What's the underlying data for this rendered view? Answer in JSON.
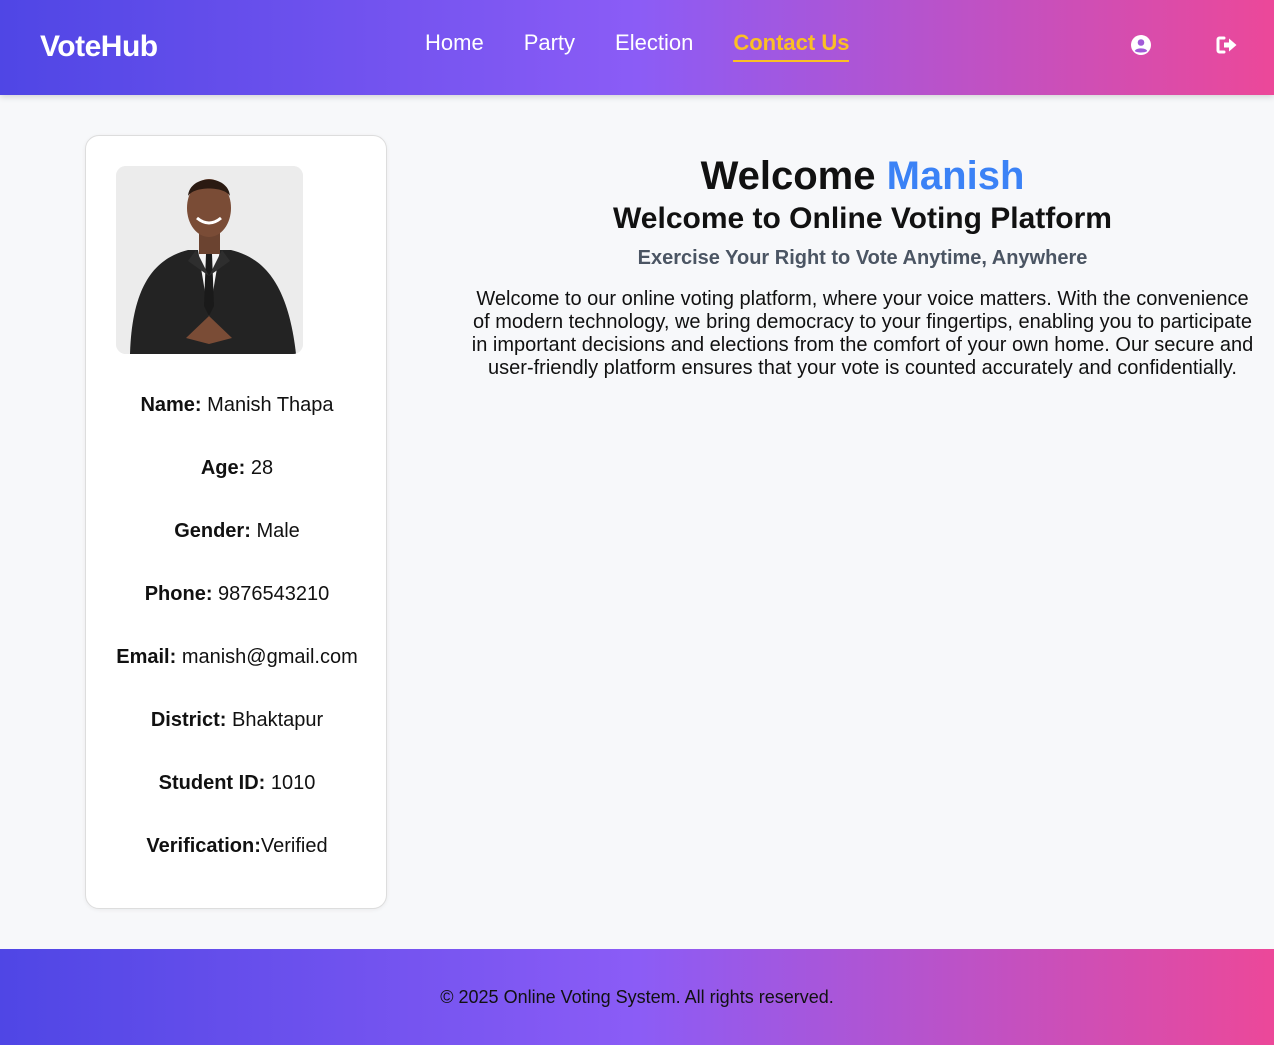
{
  "navbar": {
    "brand": "VoteHub",
    "links": [
      {
        "label": "Home",
        "active": false
      },
      {
        "label": "Party",
        "active": false
      },
      {
        "label": "Election",
        "active": false
      },
      {
        "label": "Contact Us",
        "active": true
      }
    ],
    "icons": [
      "user-circle-icon",
      "logout-icon"
    ]
  },
  "profile": {
    "name_label": "Name:",
    "name": "Manish Thapa",
    "age_label": "Age:",
    "age": "28",
    "gender_label": "Gender:",
    "gender": "Male",
    "phone_label": "Phone:",
    "phone": "9876543210",
    "email_label": "Email:",
    "email": "manish@gmail.com",
    "district_label": "District:",
    "district": "Bhaktapur",
    "student_id_label": "Student ID:",
    "student_id": "1010",
    "verification_label": "Verification:",
    "verification": "Verified"
  },
  "main": {
    "welcome_prefix": "Welcome",
    "welcome_name": "Manish",
    "platform_title": "Welcome to Online Voting Platform",
    "tagline": "Exercise Your Right to Vote Anytime, Anywhere",
    "description": "Welcome to our online voting platform, where your voice matters. With the convenience of modern technology, we bring democracy to your fingertips, enabling you to participate in important decisions and elections from the comfort of your own home. Our secure and user-friendly platform ensures that your vote is counted accurately and confidentially."
  },
  "footer": {
    "text": "© 2025 Online Voting System. All rights reserved."
  },
  "colors": {
    "gradient_start": "#4f46e5",
    "gradient_mid": "#8b5cf6",
    "gradient_end": "#ec4899",
    "active_link": "#fbbf24",
    "name_accent": "#3b82f6"
  }
}
